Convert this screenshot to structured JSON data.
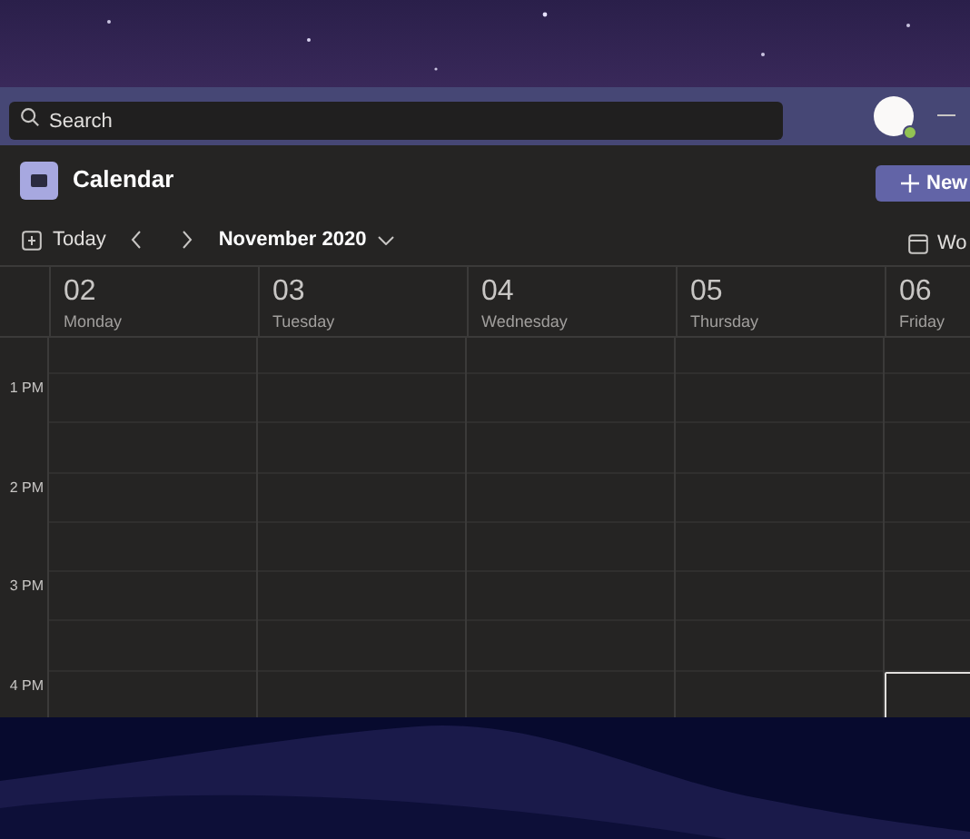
{
  "title_bar": {
    "search": {
      "placeholder": "Search"
    },
    "available": true
  },
  "header": {
    "title": "Calendar",
    "new_button": "New"
  },
  "toolbar": {
    "today": "Today",
    "month": "November 2020",
    "view": "Wo"
  },
  "days": [
    {
      "number": "02",
      "name": "Monday",
      "selected": false
    },
    {
      "number": "03",
      "name": "Tuesday",
      "selected": false
    },
    {
      "number": "04",
      "name": "Wednesday",
      "selected": false
    },
    {
      "number": "05",
      "name": "Thursday",
      "selected": false
    },
    {
      "number": "06",
      "name": "Friday",
      "selected": true
    }
  ],
  "hours": [
    {
      "label": "1 PM"
    },
    {
      "label": "2 PM"
    },
    {
      "label": "3 PM"
    },
    {
      "label": "4 PM"
    }
  ]
}
